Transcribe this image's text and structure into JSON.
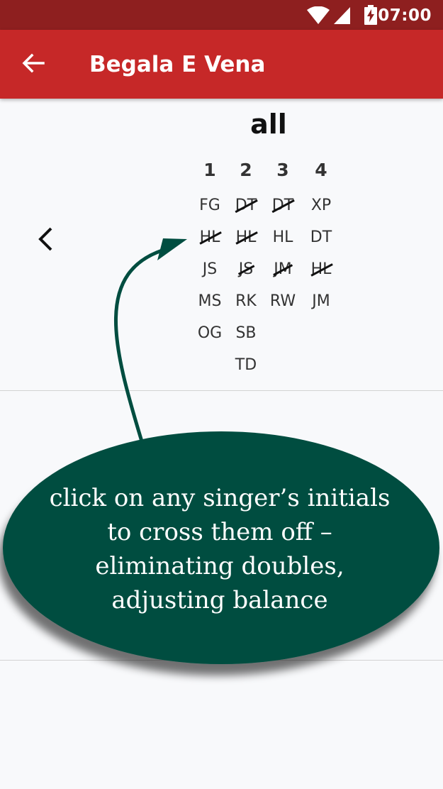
{
  "status_bar": {
    "time": "07:00",
    "icons": [
      "wifi-icon",
      "cellular-signal-icon",
      "battery-charging-icon"
    ]
  },
  "app_bar": {
    "title": "Begala E Vena",
    "back_icon": "arrow-left-icon"
  },
  "section": {
    "title": "all",
    "prev_icon": "chevron-left-icon"
  },
  "columns": [
    {
      "header": "1",
      "singers": [
        {
          "initials": "FG",
          "crossed": false
        },
        {
          "initials": "HL",
          "crossed": true
        },
        {
          "initials": "JS",
          "crossed": false
        },
        {
          "initials": "MS",
          "crossed": false
        },
        {
          "initials": "OG",
          "crossed": false
        }
      ]
    },
    {
      "header": "2",
      "singers": [
        {
          "initials": "DT",
          "crossed": true
        },
        {
          "initials": "HL",
          "crossed": true
        },
        {
          "initials": "JS",
          "crossed": true
        },
        {
          "initials": "RK",
          "crossed": false
        },
        {
          "initials": "SB",
          "crossed": false
        },
        {
          "initials": "TD",
          "crossed": false
        }
      ]
    },
    {
      "header": "3",
      "singers": [
        {
          "initials": "DT",
          "crossed": true
        },
        {
          "initials": "HL",
          "crossed": false
        },
        {
          "initials": "JM",
          "crossed": true
        },
        {
          "initials": "RW",
          "crossed": false
        }
      ]
    },
    {
      "header": "4",
      "singers": [
        {
          "initials": "XP",
          "crossed": false
        },
        {
          "initials": "DT",
          "crossed": false
        },
        {
          "initials": "HL",
          "crossed": true
        },
        {
          "initials": "JM",
          "crossed": false
        }
      ]
    }
  ],
  "callout": {
    "lines": [
      "click on any singer’s initials",
      "to cross them off –",
      "eliminating doubles,",
      "adjusting balance"
    ],
    "color": "#004d40"
  },
  "colors": {
    "status_bar": "#8e1f1f",
    "app_bar": "#c62828",
    "background": "#f8f9fb"
  }
}
